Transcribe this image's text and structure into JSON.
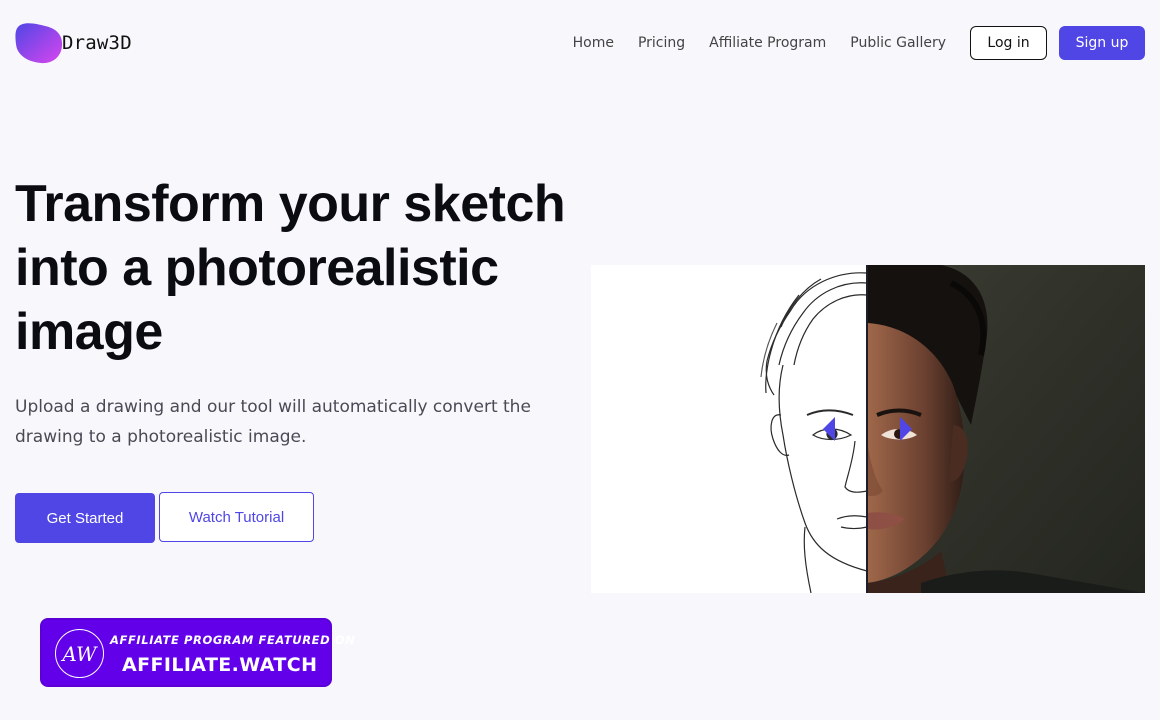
{
  "brand": {
    "name": "Draw3D",
    "logo_icon": "gradient-blob-logo",
    "gradient": [
      "#4f46e5",
      "#d946ef"
    ]
  },
  "nav": {
    "links": [
      "Home",
      "Pricing",
      "Affiliate Program",
      "Public Gallery"
    ],
    "login_label": "Log in",
    "signup_label": "Sign up"
  },
  "hero": {
    "title": "Transform your sketch into a photorealistic image",
    "subtitle": "Upload a drawing and our tool will automatically convert the drawing to a photorealistic image.",
    "primary_button": "Get Started",
    "secondary_button": "Watch Tutorial"
  },
  "comparison": {
    "left_label": "sketch-drawing",
    "right_label": "photorealistic-result",
    "handle_icons": [
      "chevron-left-icon",
      "chevron-right-icon"
    ]
  },
  "badge": {
    "icon_text": "AW",
    "line1": "AFFILIATE PROGRAM FEATURED ON",
    "line2": "AFFILIATE.WATCH"
  },
  "colors": {
    "accent": "#4f46e5",
    "background": "#f8f7fc",
    "badge": "#6200ea"
  }
}
